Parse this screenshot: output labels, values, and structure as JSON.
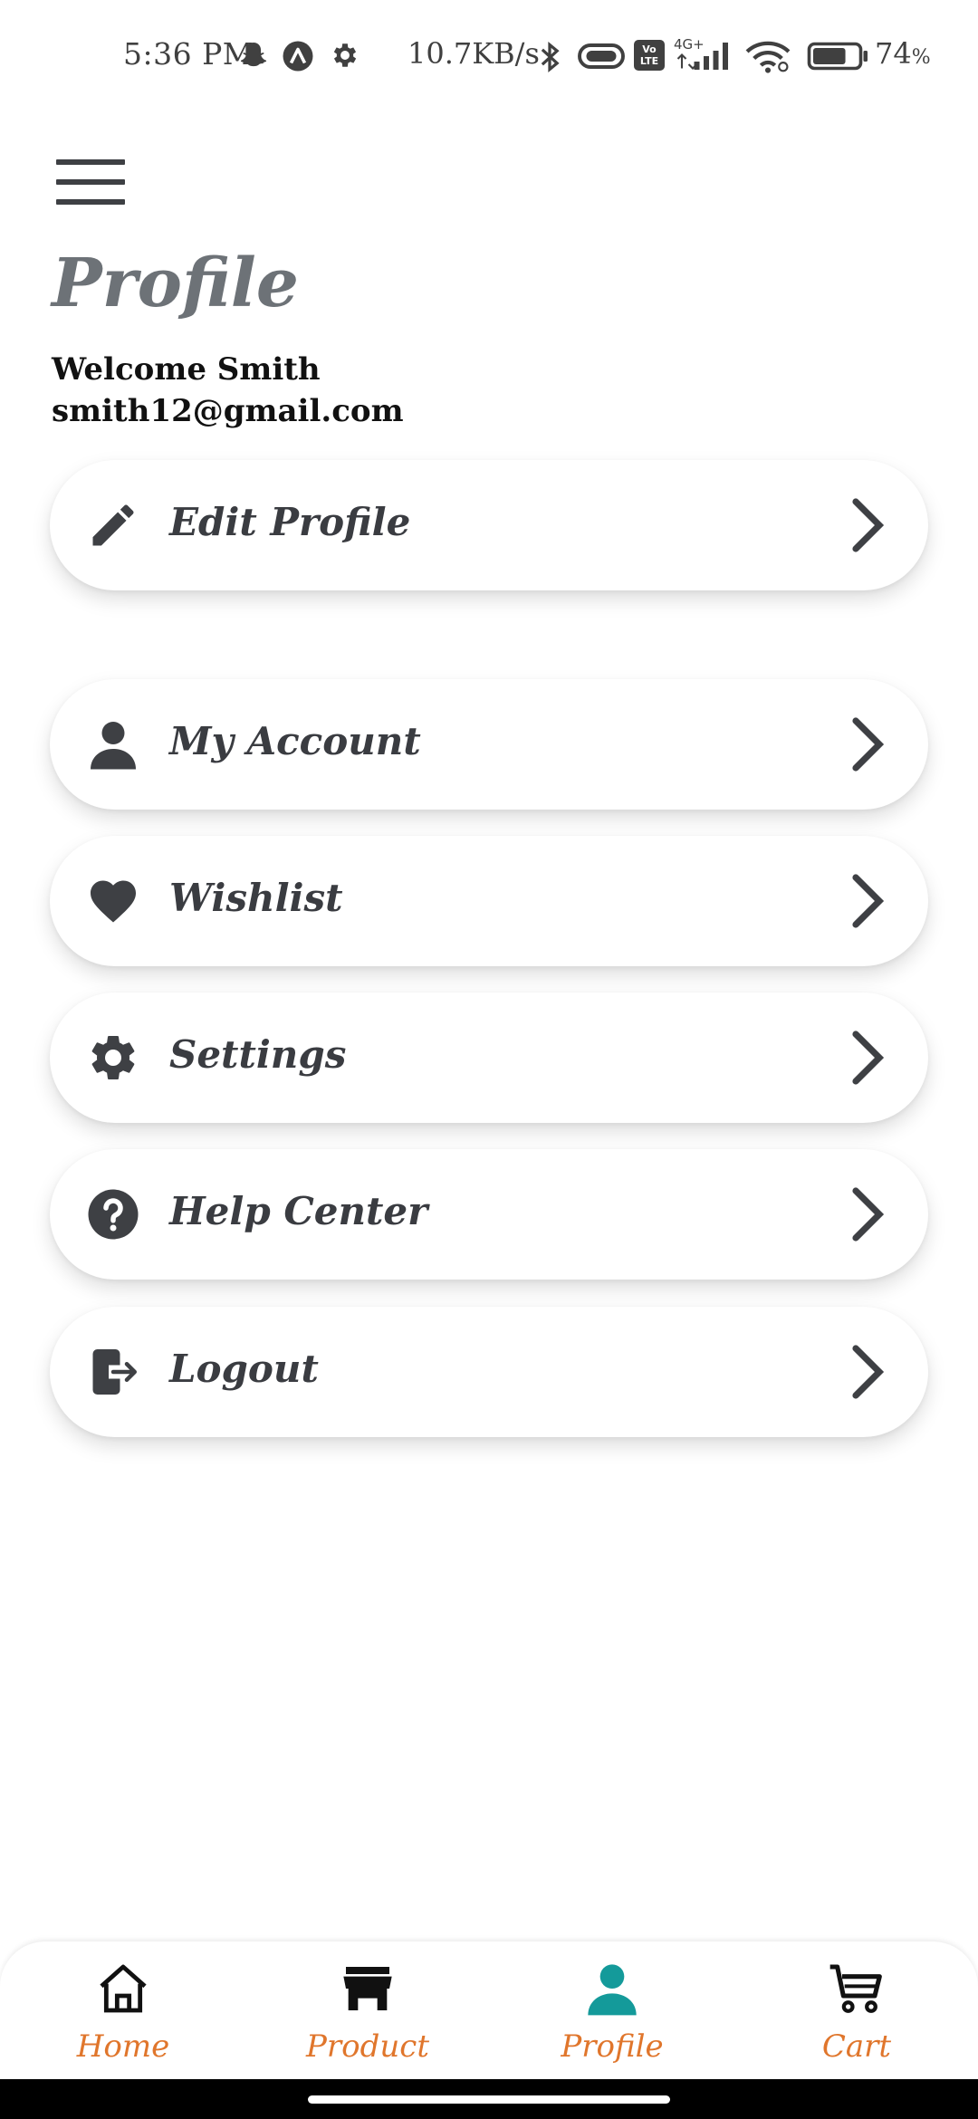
{
  "status_bar": {
    "time": "5:36 PM",
    "net_speed": "10.7KB/s",
    "network_type": "4G+",
    "volte": "Vo LTE",
    "battery_percent": "74",
    "battery_percent_sign": "%",
    "battery_level": 0.74,
    "icons": [
      "snapchat-icon",
      "app-icon",
      "settings-icon",
      "bluetooth-icon",
      "vibrate-icon",
      "volte-icon",
      "signal-icon",
      "wifi-icon",
      "battery-icon"
    ]
  },
  "header": {
    "menu_icon": "hamburger-icon",
    "title": "Profile",
    "welcome": "Welcome Smith",
    "email": "smith12@gmail.com"
  },
  "menu": {
    "items": [
      {
        "label": "Edit Profile",
        "icon": "pencil-icon"
      },
      {
        "label": "My Account",
        "icon": "person-icon"
      },
      {
        "label": "Wishlist",
        "icon": "heart-icon"
      },
      {
        "label": "Settings",
        "icon": "gear-icon"
      },
      {
        "label": "Help Center",
        "icon": "help-circle-icon"
      },
      {
        "label": "Logout",
        "icon": "logout-icon"
      }
    ]
  },
  "bottom_nav": {
    "items": [
      {
        "label": "Home",
        "icon": "home-icon"
      },
      {
        "label": "Product",
        "icon": "store-icon"
      },
      {
        "label": "Profile",
        "icon": "person-icon",
        "active": true
      },
      {
        "label": "Cart",
        "icon": "cart-icon"
      }
    ]
  },
  "colors": {
    "title": "#6d7277",
    "label": "#3a3c41",
    "nav_label": "#e0762c",
    "active_nav_icon": "#149a9a",
    "icon": "#3e4044"
  }
}
